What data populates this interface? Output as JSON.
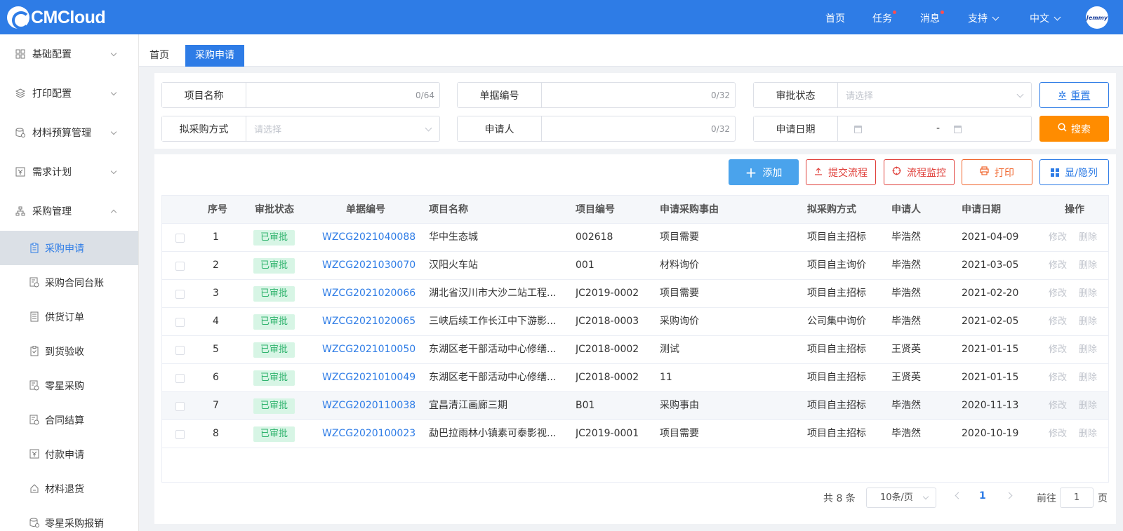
{
  "header": {
    "logo": "CMCloud",
    "nav": {
      "home": "首页",
      "task": "任务",
      "message": "消息",
      "support": "支持",
      "language": "中文"
    },
    "avatar_text": "Jemmy"
  },
  "sidebar": {
    "groups": [
      {
        "label": "基础配置",
        "icon": "grid-icon"
      },
      {
        "label": "打印配置",
        "icon": "layers-icon"
      },
      {
        "label": "材料预算管理",
        "icon": "database-icon"
      },
      {
        "label": "需求计划",
        "icon": "yen-doc-icon"
      },
      {
        "label": "采购管理",
        "icon": "org-chart-icon"
      }
    ],
    "subitems": [
      {
        "label": "采购申请",
        "icon": "clipboard-icon"
      },
      {
        "label": "采购合同台账",
        "icon": "doc-gear-icon"
      },
      {
        "label": "供货订单",
        "icon": "list-doc-icon"
      },
      {
        "label": "到货验收",
        "icon": "clipboard-check-icon"
      },
      {
        "label": "零星采购",
        "icon": "doc-gear-icon"
      },
      {
        "label": "合同结算",
        "icon": "doc-gear-icon"
      },
      {
        "label": "付款申请",
        "icon": "yen-doc-icon"
      },
      {
        "label": "材料退货",
        "icon": "return-icon"
      },
      {
        "label": "零星采购报销",
        "icon": "database-icon"
      }
    ]
  },
  "tabs": {
    "home": "首页",
    "active": "采购申请"
  },
  "filters": {
    "project_name": {
      "label": "项目名称",
      "count": "0/64"
    },
    "doc_no": {
      "label": "单据编号",
      "count": "0/32"
    },
    "approval_status": {
      "label": "审批状态",
      "placeholder": "请选择"
    },
    "purchase_method": {
      "label": "拟采购方式",
      "placeholder": "请选择"
    },
    "applicant": {
      "label": "申请人",
      "count": "0/32"
    },
    "apply_date": {
      "label": "申请日期",
      "separator": "-"
    },
    "reset_label": "重置",
    "search_label": "搜索"
  },
  "toolbar": {
    "add": "添加",
    "submit": "提交流程",
    "monitor": "流程监控",
    "print": "打印",
    "columns": "显/隐列"
  },
  "table": {
    "columns": [
      "序号",
      "审批状态",
      "单据编号",
      "项目名称",
      "项目编号",
      "申请采购事由",
      "拟采购方式",
      "申请人",
      "申请日期",
      "操作"
    ],
    "edit_label": "修改",
    "delete_label": "删除",
    "rows": [
      {
        "no": "1",
        "status": "已审批",
        "doc": "WZCG2021040088",
        "name": "华中生态城",
        "code": "002618",
        "reason": "项目需要",
        "method": "项目自主招标",
        "applicant": "毕浩然",
        "date": "2021-04-09"
      },
      {
        "no": "2",
        "status": "已审批",
        "doc": "WZCG2021030070",
        "name": "汉阳火车站",
        "code": "001",
        "reason": "材料询价",
        "method": "项目自主询价",
        "applicant": "毕浩然",
        "date": "2021-03-05"
      },
      {
        "no": "3",
        "status": "已审批",
        "doc": "WZCG2021020066",
        "name": "湖北省汉川市大沙二站工程...",
        "code": "JC2019-0002",
        "reason": "项目需要",
        "method": "项目自主招标",
        "applicant": "毕浩然",
        "date": "2021-02-20"
      },
      {
        "no": "4",
        "status": "已审批",
        "doc": "WZCG2021020065",
        "name": "三峡后续工作长江中下游影...",
        "code": "JC2018-0003",
        "reason": "采购询价",
        "method": "公司集中询价",
        "applicant": "毕浩然",
        "date": "2021-02-05"
      },
      {
        "no": "5",
        "status": "已审批",
        "doc": "WZCG2021010050",
        "name": "东湖区老干部活动中心修缮...",
        "code": "JC2018-0002",
        "reason": "测试",
        "method": "项目自主招标",
        "applicant": "王贤英",
        "date": "2021-01-15"
      },
      {
        "no": "6",
        "status": "已审批",
        "doc": "WZCG2021010049",
        "name": "东湖区老干部活动中心修缮...",
        "code": "JC2018-0002",
        "reason": "11",
        "method": "项目自主招标",
        "applicant": "王贤英",
        "date": "2021-01-15"
      },
      {
        "no": "7",
        "status": "已审批",
        "doc": "WZCG2020110038",
        "name": "宜昌清江画廊三期",
        "code": "B01",
        "reason": "采购事由",
        "method": "项目自主招标",
        "applicant": "毕浩然",
        "date": "2020-11-13"
      },
      {
        "no": "8",
        "status": "已审批",
        "doc": "WZCG2020100023",
        "name": "勐巴拉雨林小镇素可泰影视...",
        "code": "JC2019-0001",
        "reason": "项目需要",
        "method": "项目自主招标",
        "applicant": "毕浩然",
        "date": "2020-10-19"
      }
    ]
  },
  "pagination": {
    "total": "共 8 条",
    "page_size": "10条/页",
    "current": "1",
    "goto_label": "前往",
    "goto_value": "1",
    "page_suffix": "页"
  },
  "colors": {
    "primary": "#2e7ce6",
    "accent_orange": "#ff8c00",
    "danger": "#e0403b",
    "success_bg": "#d7f5e5",
    "success_text": "#2fb36d"
  }
}
